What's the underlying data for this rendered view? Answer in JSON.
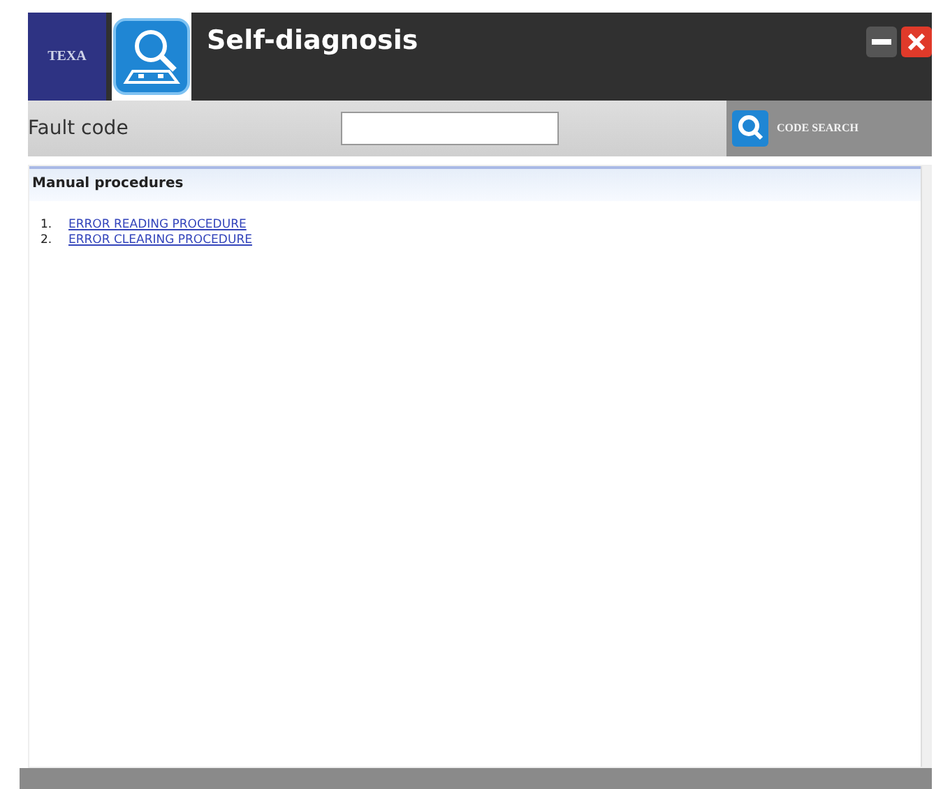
{
  "window": {
    "title": "Self-diagnosis",
    "logo": "TEXA"
  },
  "search": {
    "label": "Fault code",
    "button": "CODE SEARCH"
  },
  "section": {
    "title": "Manual procedures",
    "items": [
      {
        "number": "1.",
        "text": "ERROR READING PROCEDURE"
      },
      {
        "number": "2.",
        "text": "ERROR CLEARING PROCEDURE"
      }
    ]
  }
}
